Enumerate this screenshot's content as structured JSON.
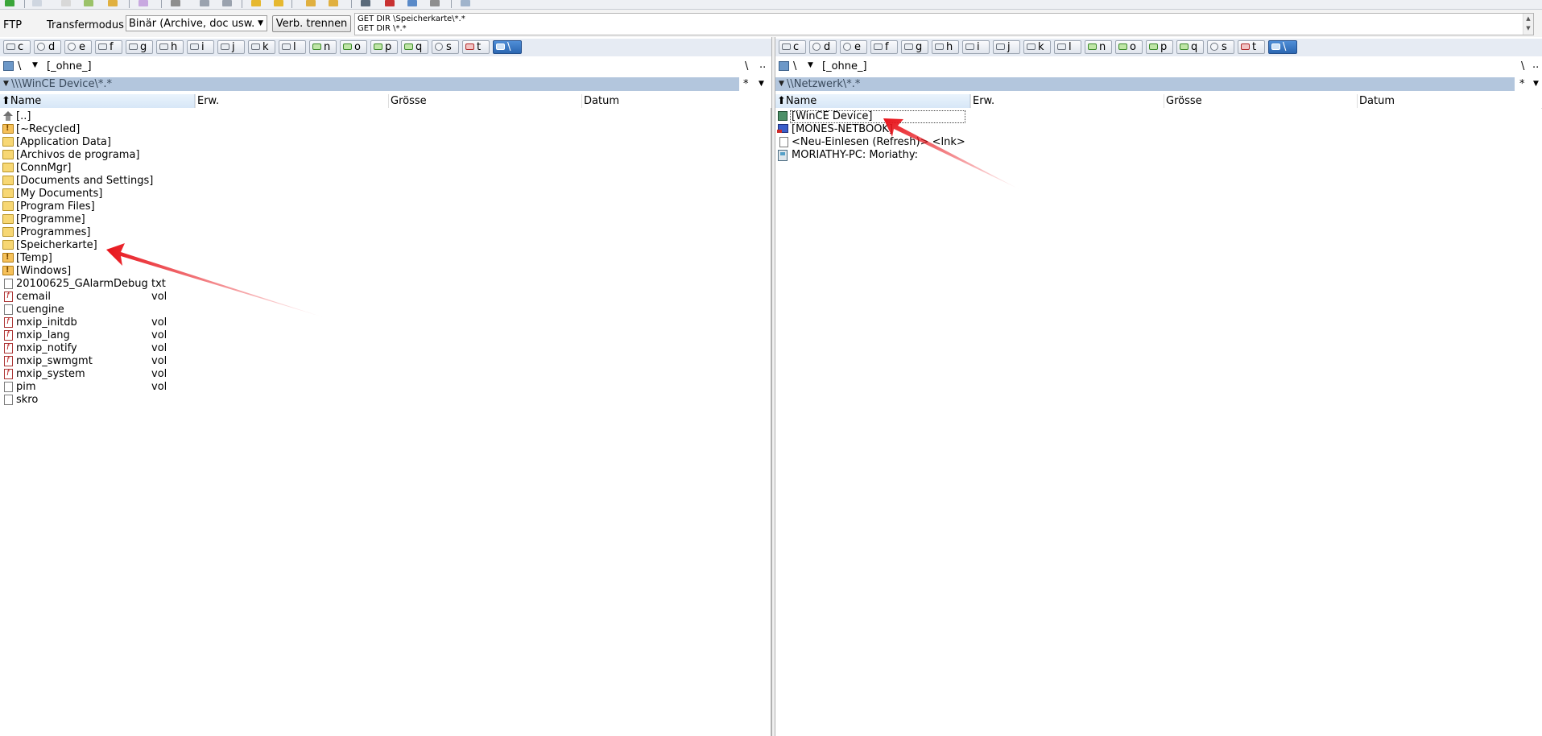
{
  "toolbar": {
    "icons": [
      "refresh-icon",
      "view-icon",
      "file-icon",
      "image-icon",
      "copy-icon",
      "move-icon",
      "edit-icon",
      "back-icon",
      "forward-icon",
      "folder-new-icon",
      "folder-open-icon",
      "compare-icon",
      "sync-icon",
      "tree-icon",
      "delete-icon",
      "transfer-icon",
      "properties-icon",
      "notes-icon"
    ]
  },
  "ftp": {
    "label": "FTP",
    "transfer_label": "Transfermodus",
    "transfer_mode": "Binär (Archive, doc usw.",
    "disconnect_label": "Verb. trennen",
    "log_lines": [
      "GET DIR \\Speicherkarte\\*.*",
      "GET DIR \\*.*"
    ]
  },
  "drives": [
    {
      "letter": "c",
      "type": "hdd"
    },
    {
      "letter": "d",
      "type": "cd"
    },
    {
      "letter": "e",
      "type": "cd"
    },
    {
      "letter": "f",
      "type": "hdd"
    },
    {
      "letter": "g",
      "type": "hdd"
    },
    {
      "letter": "h",
      "type": "hdd"
    },
    {
      "letter": "i",
      "type": "hdd"
    },
    {
      "letter": "j",
      "type": "hdd"
    },
    {
      "letter": "k",
      "type": "hdd"
    },
    {
      "letter": "l",
      "type": "hdd"
    },
    {
      "letter": "n",
      "type": "net"
    },
    {
      "letter": "o",
      "type": "net"
    },
    {
      "letter": "p",
      "type": "net"
    },
    {
      "letter": "q",
      "type": "net"
    },
    {
      "letter": "s",
      "type": "cd"
    },
    {
      "letter": "t",
      "type": "netx"
    },
    {
      "letter": "\\",
      "type": "active"
    }
  ],
  "left": {
    "drive_label": "\\",
    "filter": "[_ohne_]",
    "root_btn": "\\",
    "up_btn": "..",
    "path": "\\\\\\WinCE Device\\*.*",
    "star": "*",
    "columns": {
      "name": "Name",
      "ext": "Erw.",
      "size": "Grösse",
      "date": "Datum"
    },
    "files": [
      {
        "name": "[..]",
        "ext": "",
        "icon": "up"
      },
      {
        "name": "[~Recycled]",
        "ext": "",
        "icon": "folder-hidden"
      },
      {
        "name": "[Application Data]",
        "ext": "",
        "icon": "folder"
      },
      {
        "name": "[Archivos de programa]",
        "ext": "",
        "icon": "folder"
      },
      {
        "name": "[ConnMgr]",
        "ext": "",
        "icon": "folder"
      },
      {
        "name": "[Documents and Settings]",
        "ext": "",
        "icon": "folder"
      },
      {
        "name": "[My Documents]",
        "ext": "",
        "icon": "folder"
      },
      {
        "name": "[Program Files]",
        "ext": "",
        "icon": "folder"
      },
      {
        "name": "[Programme]",
        "ext": "",
        "icon": "folder"
      },
      {
        "name": "[Programmes]",
        "ext": "",
        "icon": "folder"
      },
      {
        "name": "[Speicherkarte]",
        "ext": "",
        "icon": "folder"
      },
      {
        "name": "[Temp]",
        "ext": "",
        "icon": "folder-hidden"
      },
      {
        "name": "[Windows]",
        "ext": "",
        "icon": "folder-hidden"
      },
      {
        "name": "20100625_GAlarmDebug",
        "ext": "txt",
        "icon": "file"
      },
      {
        "name": "cemail",
        "ext": "vol",
        "icon": "file-red"
      },
      {
        "name": "cuengine",
        "ext": "",
        "icon": "file"
      },
      {
        "name": "mxip_initdb",
        "ext": "vol",
        "icon": "file-red"
      },
      {
        "name": "mxip_lang",
        "ext": "vol",
        "icon": "file-red"
      },
      {
        "name": "mxip_notify",
        "ext": "vol",
        "icon": "file-red"
      },
      {
        "name": "mxip_swmgmt",
        "ext": "vol",
        "icon": "file-red"
      },
      {
        "name": "mxip_system",
        "ext": "vol",
        "icon": "file-red"
      },
      {
        "name": "pim",
        "ext": "vol",
        "icon": "file"
      },
      {
        "name": "skro",
        "ext": "",
        "icon": "file"
      }
    ]
  },
  "right": {
    "drive_label": "\\",
    "filter": "[_ohne_]",
    "root_btn": "\\",
    "up_btn": "..",
    "path": "\\\\Netzwerk\\*.*",
    "star": "*",
    "columns": {
      "name": "Name",
      "ext": "Erw.",
      "size": "Grösse",
      "date": "Datum"
    },
    "files": [
      {
        "name": "[WinCE Device]",
        "ext": "",
        "icon": "device"
      },
      {
        "name": "[MONES-NETBOOK]",
        "ext": "",
        "icon": "computer"
      },
      {
        "name": "<Neu-Einlesen (Refresh)> <lnk>",
        "ext": "",
        "icon": "file"
      },
      {
        "name": "MORIATHY-PC: Moriathy:",
        "ext": "",
        "icon": "netpc"
      }
    ]
  },
  "colors": {
    "arrow": "#e8141b",
    "pathbar": "#b3c6dd",
    "drivebar": "#e6ebf3"
  }
}
